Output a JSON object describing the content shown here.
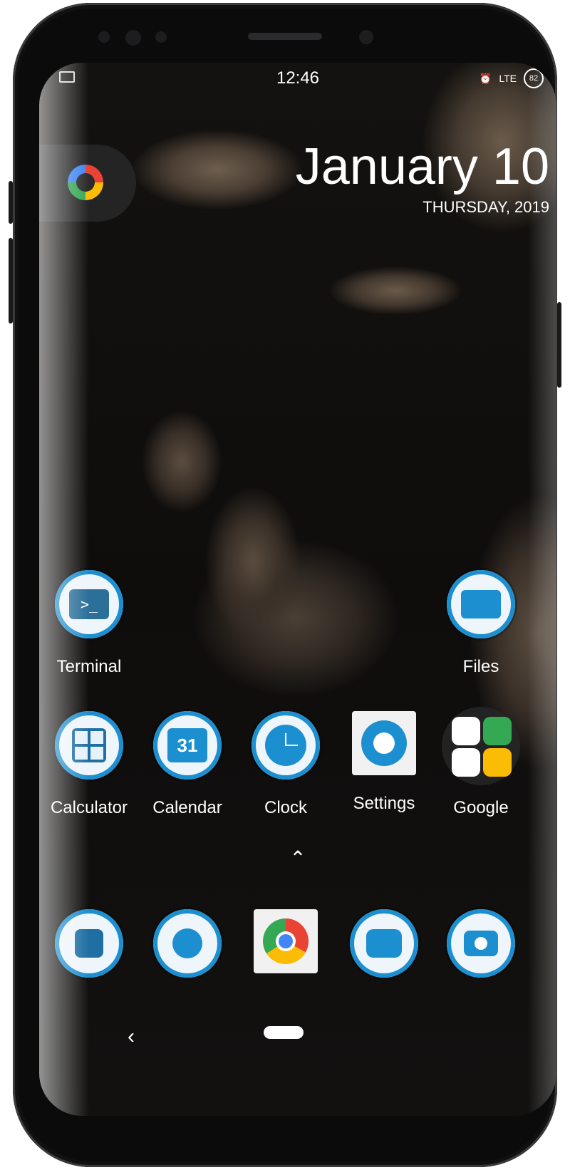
{
  "status": {
    "time": "12:46",
    "network": "LTE",
    "battery": "82"
  },
  "date": {
    "month_day": "January 10",
    "weekday_year": "THURSDAY, 2019"
  },
  "apps_row1": [
    {
      "label": "Terminal"
    },
    {
      "label": "Files"
    }
  ],
  "apps_row2": [
    {
      "label": "Calculator"
    },
    {
      "label": "Calendar",
      "icon_text": "31"
    },
    {
      "label": "Clock"
    },
    {
      "label": "Settings"
    },
    {
      "label": "Google"
    }
  ],
  "nav": {
    "back_glyph": "‹",
    "drawer_glyph": "⌃"
  },
  "colors": {
    "accent": "#1c8fd1",
    "folder_bg": "#2b2b2b"
  }
}
